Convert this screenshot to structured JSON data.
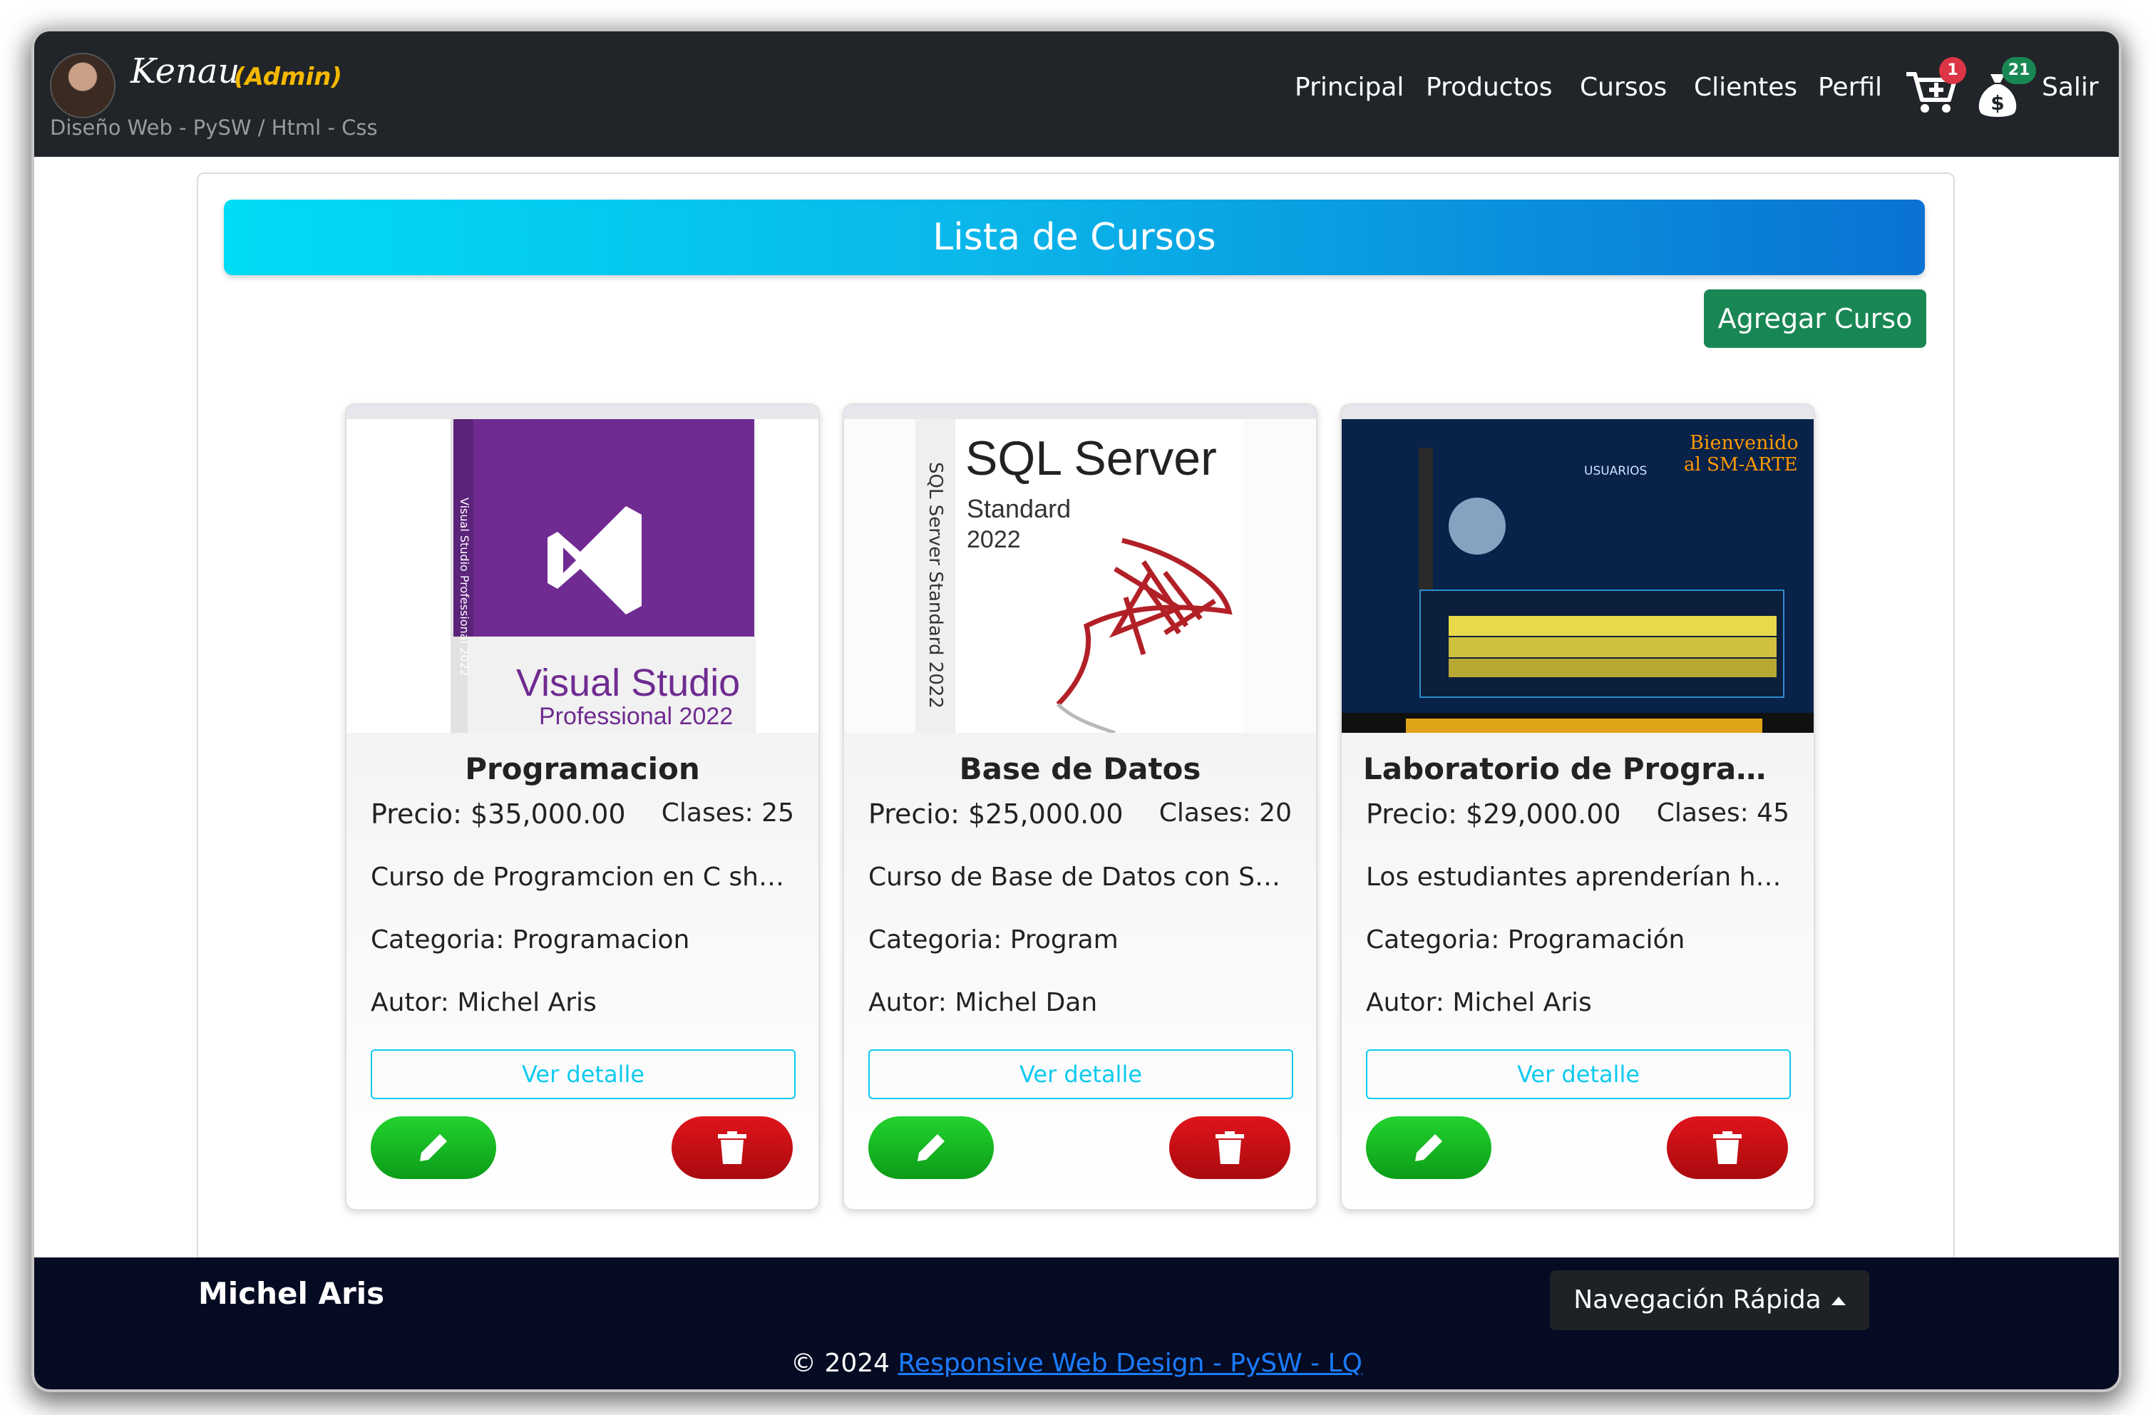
{
  "navbar": {
    "brand_name": "Kenau",
    "brand_role": "(Admin)",
    "brand_subtitle": "Diseño Web - PySW / Html - Css",
    "links": [
      "Principal",
      "Productos",
      "Cursos",
      "Clientes",
      "Perfil"
    ],
    "cart_badge": "1",
    "money_badge": "21",
    "logout_label": "Salir",
    "cart_icon": "cart-plus-icon",
    "money_icon": "money-bag-icon"
  },
  "page": {
    "title": "Lista de Cursos",
    "add_button_label": "Agregar Curso"
  },
  "courses": [
    {
      "image_text": {
        "line1": "Visual Studio",
        "line2": "Professional 2022",
        "spine": "Visual Studio Professional 2022"
      },
      "title": "Programacion",
      "price": "Precio: $35,000.00",
      "classes": "Clases: 25",
      "description": "Curso de Programcion en C sha…",
      "category": "Categoria: Programacion",
      "author": "Autor: Michel Aris",
      "detail_label": "Ver detalle"
    },
    {
      "image_text": {
        "line1": "SQL Server",
        "line2": "Standard",
        "line3": "2022",
        "spine": "SQL Server Standard 2022"
      },
      "title": "Base de Datos",
      "price": "Precio: $25,000.00",
      "classes": "Clases: 20",
      "description": "Curso de Base de Datos con Sql …",
      "category": "Categoria: Program",
      "author": "Autor: Michel Dan",
      "detail_label": "Ver detalle"
    },
    {
      "image_text": {
        "line1": "Bienvenido",
        "line2": "al SM-ARTE",
        "panel": "USUARIOS"
      },
      "title": "Laboratorio de Programa…",
      "price": "Precio: $29,000.00",
      "classes": "Clases: 45",
      "description": "Los estudiantes aprenderían ha…",
      "category": "Categoria: Programación",
      "author": "Autor: Michel Aris",
      "detail_label": "Ver detalle"
    }
  ],
  "footer": {
    "author": "Michel Aris",
    "quick_nav_label": "Navegación Rápida",
    "copyright_prefix": "© 2024",
    "copyright_link": "Responsive Web Design - PySW - LQ"
  },
  "colors": {
    "navbar_bg": "#212529",
    "banner_start": "#00dcf5",
    "banner_end": "#0a72d2",
    "add_button": "#198754",
    "edit_button": "#16b822",
    "delete_button": "#c90f15",
    "outline_info": "#0dcaf0",
    "footer_bg": "#050b22",
    "admin_label": "#f5b800"
  },
  "icons": {
    "edit": "pencil-icon",
    "delete": "trash-icon"
  }
}
